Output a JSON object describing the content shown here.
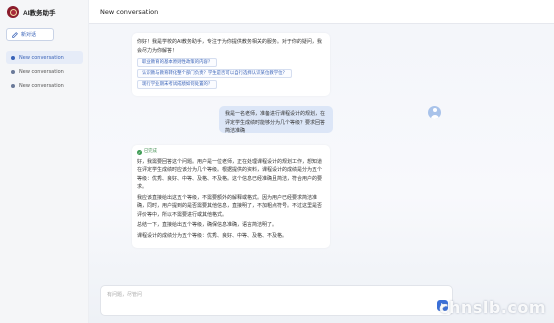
{
  "app": {
    "title": "AI教务助手",
    "new_chat_label": "新对话"
  },
  "conversations": [
    {
      "label": "New conversation",
      "active": true
    },
    {
      "label": "New conversation",
      "active": false
    },
    {
      "label": "New conversation",
      "active": false
    }
  ],
  "header": {
    "title": "New conversation"
  },
  "messages": {
    "greeting": "你好！我是学校的AI教务助手，专注于为你提供教务相关的服务。对于你的疑问，我会尽力为你解答！",
    "suggestions": [
      "职业教育的基本原则性政策的内容？",
      "认识教与教育转化整个部门负责？学生是否可以自行选择认识某位教学位？",
      "现行学业期末考试成绩如何处置的？"
    ],
    "user_question": "我是一名老师，准备进行课程设计的规划，在评定学生成绩时能够分为几个等级？要求回答简洁准确",
    "status_label": "已完成",
    "answer_paragraphs": [
      "好，我需要回答这个问题。用户是一位老师，正在处理课程设计的规划工作，想知道在评定学生成绩时应该分为几个等级。根据提供的资料，课程设计的成绩是分为五个等级：优秀、良好、中等、及格、不及格。这个信息已经准确且简洁，符合用户的要求。",
      "我应该直接给出这五个等级，不需要额外的解释或格式。因为用户已经要求简洁准确，同时，用户提到的是否需要其他信息，直接明了，不加粗点符号。不过这里是否评价等中，所以不需要进行或其他格式。",
      "总结一下，直接给出五个等级，确保信息准确，语言简洁明了。",
      "课程设计的成绩分为五个等级：优秀、良好、中等、及格、不及格。"
    ]
  },
  "composer": {
    "placeholder": "有问题，尽管问",
    "value": ""
  },
  "watermark": "chnslb.com",
  "colors": {
    "accent": "#3a6fd8",
    "brand": "#8b1c2c",
    "user_bubble": "#dce6f7"
  }
}
